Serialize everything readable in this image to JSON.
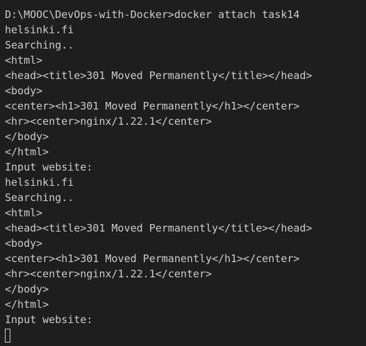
{
  "terminal": {
    "lines": [
      "D:\\MOOC\\DevOps-with-Docker>docker attach task14",
      "helsinki.fi",
      "Searching..",
      "<html>",
      "<head><title>301 Moved Permanently</title></head>",
      "<body>",
      "<center><h1>301 Moved Permanently</h1></center>",
      "<hr><center>nginx/1.22.1</center>",
      "</body>",
      "</html>",
      "Input website:",
      "helsinki.fi",
      "Searching..",
      "<html>",
      "<head><title>301 Moved Permanently</title></head>",
      "<body>",
      "<center><h1>301 Moved Permanently</h1></center>",
      "<hr><center>nginx/1.22.1</center>",
      "</body>",
      "</html>",
      "Input website:"
    ]
  }
}
